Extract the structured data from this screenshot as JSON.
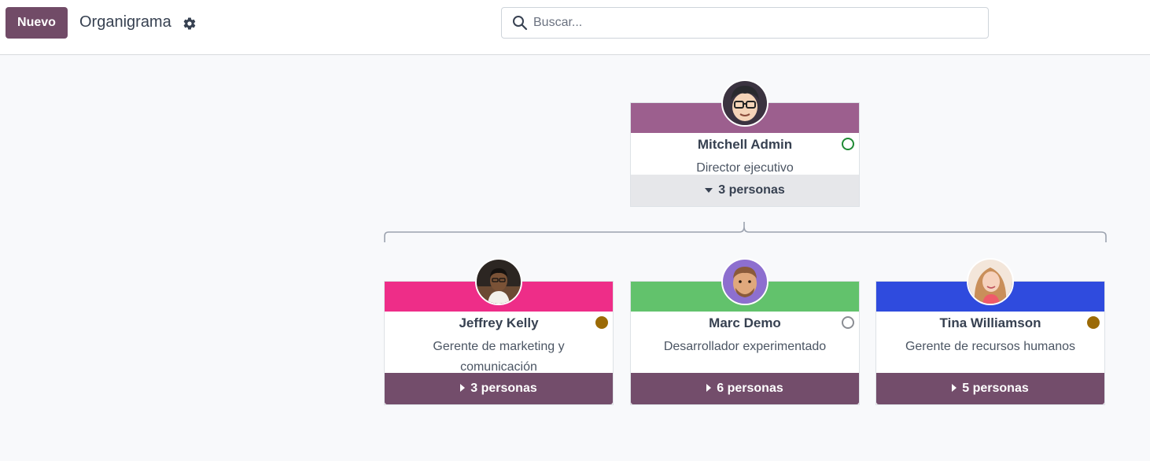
{
  "toolbar": {
    "new_label": "Nuevo",
    "breadcrumb": "Organigrama",
    "settings_icon": "gear-icon"
  },
  "search": {
    "placeholder": "Buscar...",
    "value": "",
    "icon": "search-icon"
  },
  "manager": {
    "name": "Mitchell Admin",
    "job": "Director ejecutivo",
    "band_color": "#9c5f8e",
    "status": "online",
    "status_color": "#1f8a34",
    "subordinates_label": "3 personas",
    "expanded": true
  },
  "employees": [
    {
      "name": "Jeffrey Kelly",
      "job": "Gerente de marketing y comunicación",
      "band_color": "#ee2d88",
      "status": "away",
      "status_color": "#9b6a06",
      "subordinates_label": "3 personas"
    },
    {
      "name": "Marc Demo",
      "job": "Desarrollador experimentado",
      "band_color": "#62c26c",
      "status": "offline",
      "status_color": "#8a8d93",
      "subordinates_label": "6 personas"
    },
    {
      "name": "Tina Williamson",
      "job": "Gerente de recursos humanos",
      "band_color": "#2f4bde",
      "status": "away",
      "status_color": "#9b6a06",
      "subordinates_label": "5 personas"
    }
  ],
  "colors": {
    "primary": "#714b67",
    "expand_button": "#734d6b"
  }
}
